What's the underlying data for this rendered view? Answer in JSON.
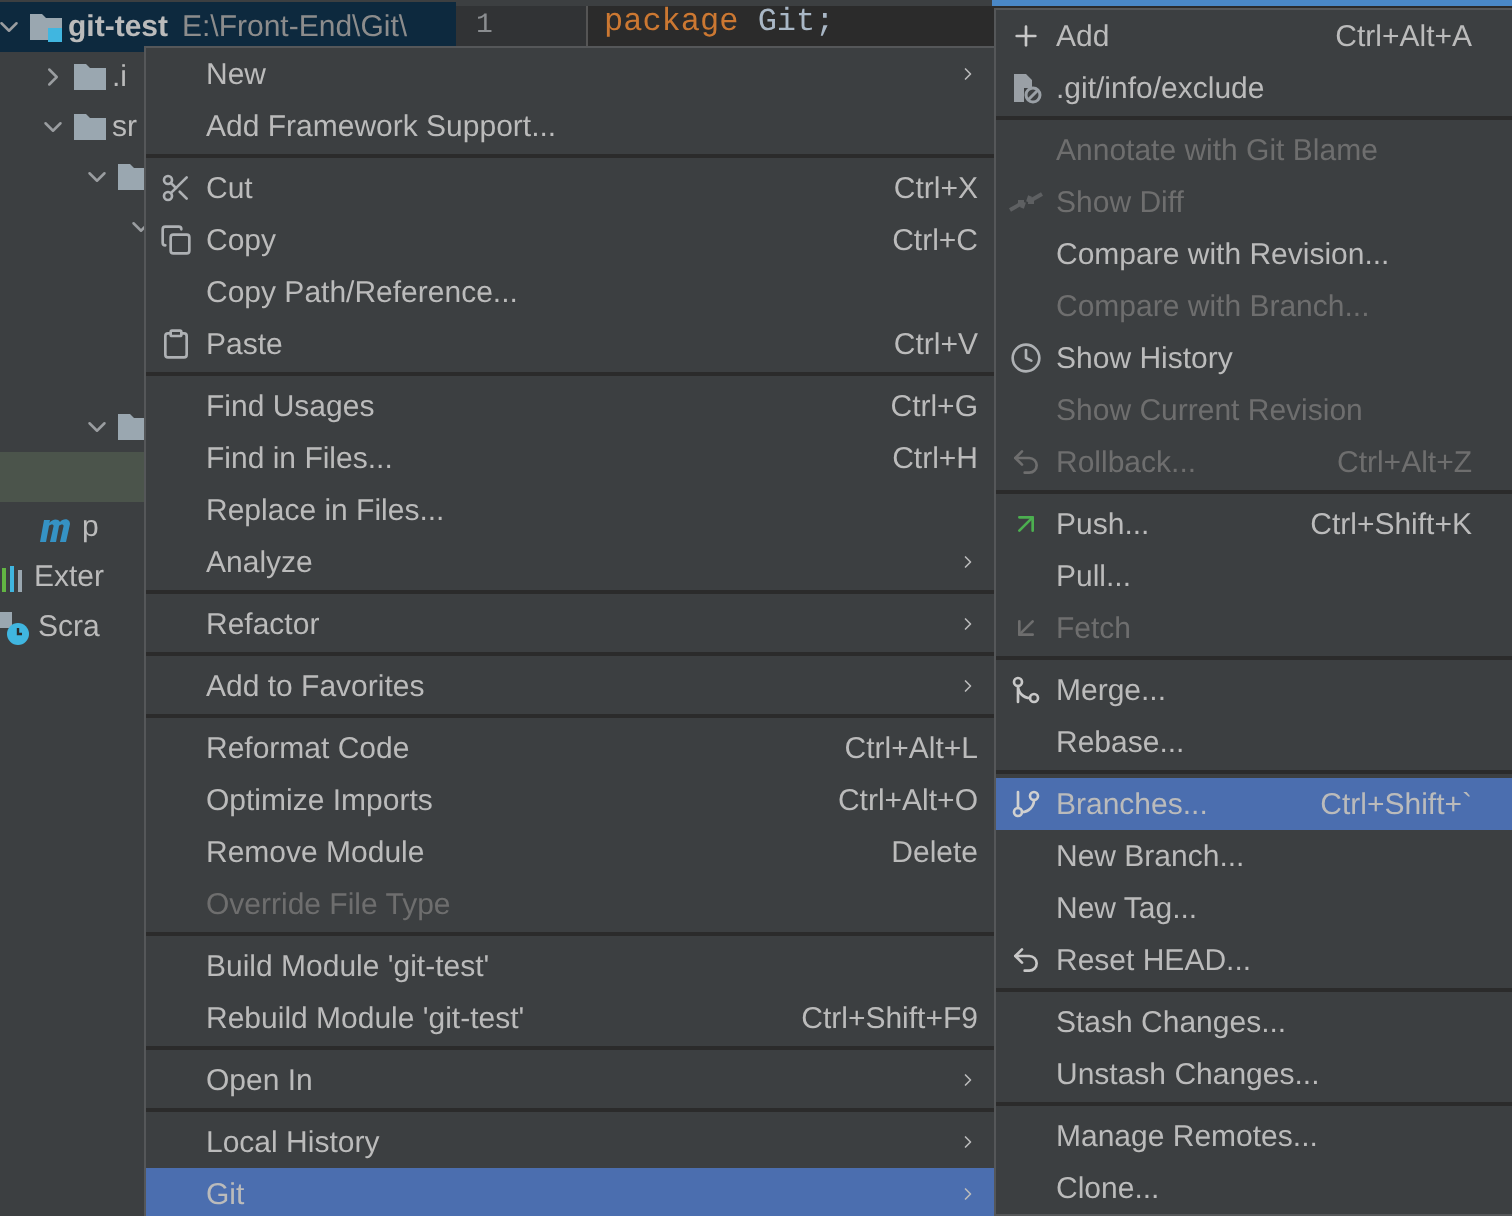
{
  "project_tree": {
    "items": [
      {
        "label": "git-test",
        "path": "E:\\Front-End\\Git\\",
        "kind": "module",
        "expanded": true,
        "selected": true,
        "current": false,
        "children": [
          {
            "label": ".i",
            "kind": "folder",
            "expanded": false,
            "selected": false,
            "current": false
          },
          {
            "label": "sr",
            "kind": "folder",
            "expanded": true,
            "selected": false,
            "current": false,
            "children": [
              {
                "kind": "folder",
                "expanded": true,
                "selected": false,
                "current": false,
                "children": [
                  {
                    "kind": "covered",
                    "expanded": true
                  }
                ]
              },
              {
                "kind": "folder",
                "expanded": true,
                "selected": false,
                "current": false,
                "children": [
                  {
                    "kind": "blank",
                    "selected": false,
                    "current": true
                  }
                ]
              }
            ]
          },
          {
            "label": "p",
            "kind": "maven",
            "selected": false,
            "current": false
          }
        ]
      },
      {
        "label": "Exter",
        "kind": "libraries",
        "selected": false,
        "current": false
      },
      {
        "label": "Scra",
        "kind": "scratches",
        "selected": false,
        "current": false
      }
    ]
  },
  "editor": {
    "line_numbers": [
      "1"
    ],
    "code": [
      {
        "keyword": "package",
        "rest": " Git;"
      }
    ]
  },
  "context_menu": {
    "items": [
      {
        "kind": "item",
        "label": "New",
        "submenu": true,
        "disabled": false,
        "selected": false
      },
      {
        "kind": "item",
        "label": "Add Framework Support...",
        "submenu": false,
        "disabled": false,
        "selected": false
      },
      {
        "kind": "separator"
      },
      {
        "kind": "item",
        "label": "Cut",
        "shortcut": "Ctrl+X",
        "submenu": false,
        "disabled": false,
        "selected": false
      },
      {
        "kind": "item",
        "label": "Copy",
        "shortcut": "Ctrl+C",
        "submenu": false,
        "disabled": false,
        "selected": false
      },
      {
        "kind": "item",
        "label": "Copy Path/Reference...",
        "submenu": false,
        "disabled": false,
        "selected": false
      },
      {
        "kind": "item",
        "label": "Paste",
        "shortcut": "Ctrl+V",
        "submenu": false,
        "disabled": false,
        "selected": false
      },
      {
        "kind": "separator"
      },
      {
        "kind": "item",
        "label": "Find Usages",
        "shortcut": "Ctrl+G",
        "submenu": false,
        "disabled": false,
        "selected": false
      },
      {
        "kind": "item",
        "label": "Find in Files...",
        "shortcut": "Ctrl+H",
        "submenu": false,
        "disabled": false,
        "selected": false
      },
      {
        "kind": "item",
        "label": "Replace in Files...",
        "submenu": false,
        "disabled": false,
        "selected": false
      },
      {
        "kind": "item",
        "label": "Analyze",
        "submenu": true,
        "disabled": false,
        "selected": false
      },
      {
        "kind": "separator"
      },
      {
        "kind": "item",
        "label": "Refactor",
        "submenu": true,
        "disabled": false,
        "selected": false
      },
      {
        "kind": "separator"
      },
      {
        "kind": "item",
        "label": "Add to Favorites",
        "submenu": true,
        "disabled": false,
        "selected": false
      },
      {
        "kind": "separator"
      },
      {
        "kind": "item",
        "label": "Reformat Code",
        "shortcut": "Ctrl+Alt+L",
        "submenu": false,
        "disabled": false,
        "selected": false
      },
      {
        "kind": "item",
        "label": "Optimize Imports",
        "shortcut": "Ctrl+Alt+O",
        "submenu": false,
        "disabled": false,
        "selected": false
      },
      {
        "kind": "item",
        "label": "Remove Module",
        "shortcut": "Delete",
        "submenu": false,
        "disabled": false,
        "selected": false
      },
      {
        "kind": "item",
        "label": "Override File Type",
        "submenu": false,
        "disabled": true,
        "selected": false
      },
      {
        "kind": "separator"
      },
      {
        "kind": "item",
        "label": "Build Module 'git-test'",
        "submenu": false,
        "disabled": false,
        "selected": false
      },
      {
        "kind": "item",
        "label": "Rebuild Module 'git-test'",
        "shortcut": "Ctrl+Shift+F9",
        "submenu": false,
        "disabled": false,
        "selected": false
      },
      {
        "kind": "separator"
      },
      {
        "kind": "item",
        "label": "Open In",
        "submenu": true,
        "disabled": false,
        "selected": false
      },
      {
        "kind": "separator"
      },
      {
        "kind": "item",
        "label": "Local History",
        "submenu": true,
        "disabled": false,
        "selected": false
      },
      {
        "kind": "item",
        "label": "Git",
        "submenu": true,
        "disabled": false,
        "selected": true
      }
    ]
  },
  "git_submenu": {
    "items": [
      {
        "kind": "item",
        "label": "Add",
        "shortcut": "Ctrl+Alt+A",
        "disabled": false,
        "selected": false
      },
      {
        "kind": "item",
        "label": ".git/info/exclude",
        "disabled": false,
        "selected": false
      },
      {
        "kind": "separator"
      },
      {
        "kind": "item",
        "label": "Annotate with Git Blame",
        "disabled": true,
        "selected": false
      },
      {
        "kind": "item",
        "label": "Show Diff",
        "disabled": true,
        "selected": false
      },
      {
        "kind": "item",
        "label": "Compare with Revision...",
        "disabled": false,
        "selected": false
      },
      {
        "kind": "item",
        "label": "Compare with Branch...",
        "disabled": true,
        "selected": false
      },
      {
        "kind": "item",
        "label": "Show History",
        "disabled": false,
        "selected": false
      },
      {
        "kind": "item",
        "label": "Show Current Revision",
        "disabled": true,
        "selected": false
      },
      {
        "kind": "item",
        "label": "Rollback...",
        "shortcut": "Ctrl+Alt+Z",
        "disabled": true,
        "selected": false
      },
      {
        "kind": "separator"
      },
      {
        "kind": "item",
        "label": "Push...",
        "shortcut": "Ctrl+Shift+K",
        "disabled": false,
        "selected": false
      },
      {
        "kind": "item",
        "label": "Pull...",
        "disabled": false,
        "selected": false
      },
      {
        "kind": "item",
        "label": "Fetch",
        "disabled": true,
        "selected": false
      },
      {
        "kind": "separator"
      },
      {
        "kind": "item",
        "label": "Merge...",
        "disabled": false,
        "selected": false
      },
      {
        "kind": "item",
        "label": "Rebase...",
        "disabled": false,
        "selected": false
      },
      {
        "kind": "separator"
      },
      {
        "kind": "item",
        "label": "Branches...",
        "shortcut": "Ctrl+Shift+`",
        "disabled": false,
        "selected": true
      },
      {
        "kind": "item",
        "label": "New Branch...",
        "disabled": false,
        "selected": false
      },
      {
        "kind": "item",
        "label": "New Tag...",
        "disabled": false,
        "selected": false
      },
      {
        "kind": "item",
        "label": "Reset HEAD...",
        "disabled": false,
        "selected": false
      },
      {
        "kind": "separator"
      },
      {
        "kind": "item",
        "label": "Stash Changes...",
        "disabled": false,
        "selected": false
      },
      {
        "kind": "item",
        "label": "Unstash Changes...",
        "disabled": false,
        "selected": false
      },
      {
        "kind": "separator"
      },
      {
        "kind": "item",
        "label": "Manage Remotes...",
        "disabled": false,
        "selected": false
      },
      {
        "kind": "item",
        "label": "Clone...",
        "disabled": false,
        "selected": false
      }
    ]
  }
}
